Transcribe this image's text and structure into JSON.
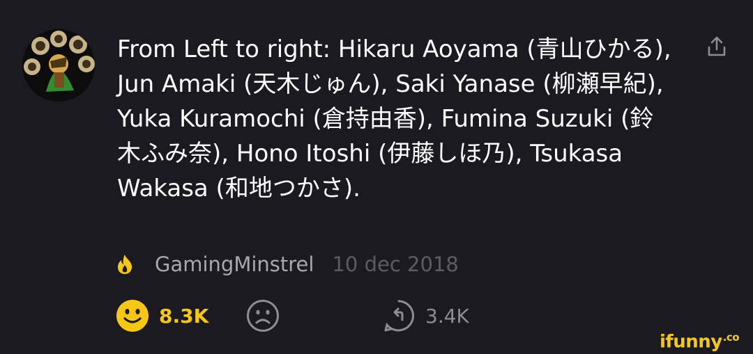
{
  "comment": {
    "text": "From Left to right: Hikaru Aoyama (青山ひかる), Jun Amaki (天木じゅん), Saki Yanase (柳瀬早紀), Yuka Kuramochi (倉持由香), Fumina Suzuki (鈴木ふみ奈), Hono Itoshi (伊藤しほ乃), Tsukasa Wakasa (和地つかさ).",
    "author": "GamingMinstrel",
    "date": "10 dec 2018",
    "author_badge_icon": "flame-icon"
  },
  "actions": {
    "like_count": "8.3K",
    "like_icon": "smile-icon",
    "dislike_icon": "sad-face-icon",
    "republish_count": "3.4K",
    "republish_icon": "republish-icon",
    "share_icon": "share-icon"
  },
  "colors": {
    "background": "#1b1a20",
    "accent": "#f6c814",
    "text": "#ffffff",
    "muted": "#a9a8ad",
    "dim": "#5d5c62"
  },
  "watermark": {
    "brand": "ifunny",
    "suffix": ".co"
  }
}
